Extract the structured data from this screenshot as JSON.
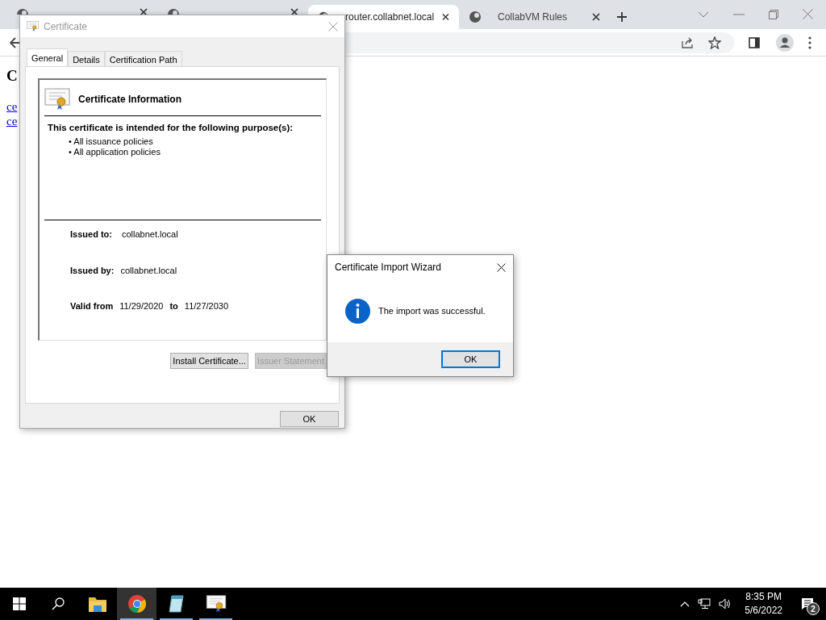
{
  "browser": {
    "tabs": [
      {
        "selected": false,
        "covered": true
      },
      {
        "selected": false,
        "covered": true
      },
      {
        "title": "router.collabnet.local",
        "selected": true
      },
      {
        "title": "CollabVM Rules",
        "selected": false
      }
    ],
    "page": {
      "heading": "C",
      "links": [
        "ce",
        "ce"
      ]
    }
  },
  "certificate_dialog": {
    "title": "Certificate",
    "tabs": [
      {
        "label": "General",
        "selected": true
      },
      {
        "label": "Details",
        "selected": false
      },
      {
        "label": "Certification Path",
        "selected": false
      }
    ],
    "info_title": "Certificate Information",
    "purpose_heading": "This certificate is intended for the following purpose(s):",
    "purposes": [
      "• All issuance policies",
      "• All application policies"
    ],
    "issued_to_label": "Issued to:",
    "issued_to": "collabnet.local",
    "issued_by_label": "Issued by:",
    "issued_by": "collabnet.local",
    "valid_from_label": "Valid from",
    "valid_from": "11/29/2020",
    "to_label": "to",
    "valid_to": "11/27/2030",
    "buttons": [
      {
        "label": "Install Certificate...",
        "disabled": false
      },
      {
        "label": "Issuer Statement",
        "disabled": true
      }
    ],
    "ok": "OK"
  },
  "wizard": {
    "title": "Certificate Import Wizard",
    "message": "The import was successful.",
    "ok": "OK"
  },
  "taskbar": {
    "apps": [
      {
        "kind": "folder",
        "selected": false,
        "running": false
      },
      {
        "kind": "chrome",
        "selected": true,
        "running": true
      },
      {
        "kind": "notepad",
        "selected": false,
        "running": true
      },
      {
        "kind": "certificate",
        "selected": false,
        "running": true
      }
    ],
    "time": "8:35 PM",
    "date": "5/6/2022",
    "notifications": "2"
  }
}
